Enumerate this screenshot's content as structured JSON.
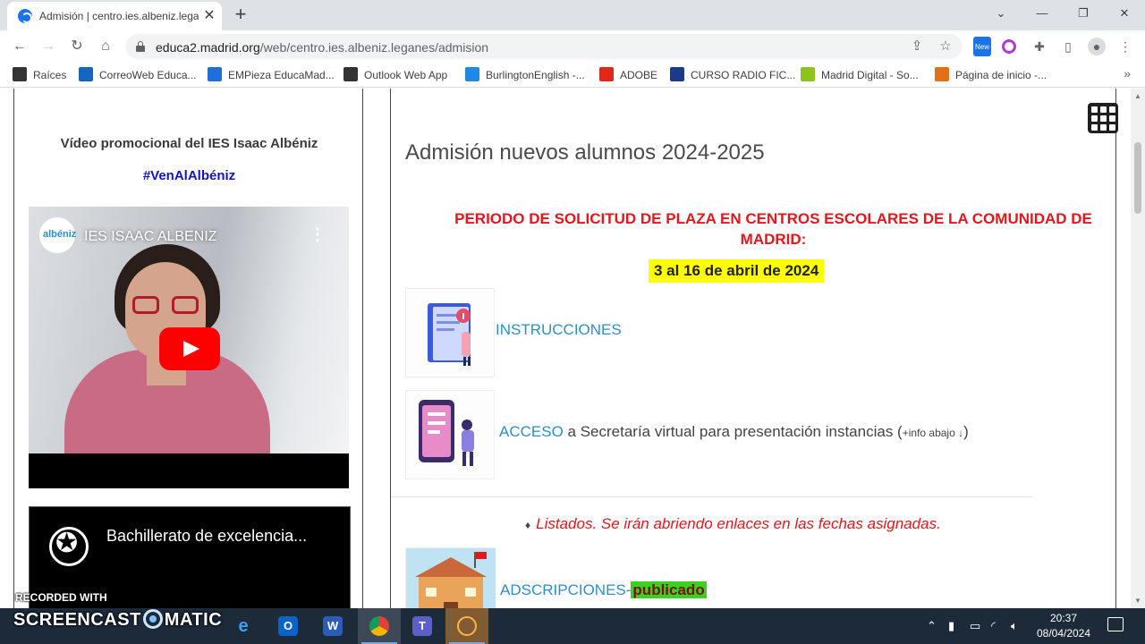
{
  "browser": {
    "tab_title": "Admisión | centro.ies.albeniz.lega",
    "url_domain": "educa2.madrid.org",
    "url_path": "/web/centro.ies.albeniz.leganes/admision",
    "ext_new_badge": "New",
    "bookmarks": [
      {
        "label": "Raíces",
        "color": "#333333"
      },
      {
        "label": "CorreoWeb Educa...",
        "color": "#1565c0"
      },
      {
        "label": "EMPieza EducaMad...",
        "color": "#1e6fd9"
      },
      {
        "label": "Outlook Web App",
        "color": "#333333"
      },
      {
        "label": "BurlingtonEnglish -...",
        "color": "#1e88e5"
      },
      {
        "label": "ADOBE",
        "color": "#e0291a"
      },
      {
        "label": "CURSO RADIO FIC...",
        "color": "#1a3a8c"
      },
      {
        "label": "Madrid Digital - So...",
        "color": "#8dc21f"
      },
      {
        "label": "Página de inicio -...",
        "color": "#e0711a"
      }
    ]
  },
  "left_panel": {
    "promo_title": "Vídeo promocional del IES Isaac Albéniz",
    "hashtag": "#VenAlAlbéniz",
    "video1": {
      "title": "IES ISAAC ALBENIZ",
      "logo_text": "albéniz",
      "menu": "⋮"
    },
    "video2": {
      "title": "Bachillerato de excelencia..."
    }
  },
  "main": {
    "title": "Admisión nuevos alumnos 2024-2025",
    "period_heading": "PERIODO DE SOLICITUD DE PLAZA EN CENTROS ESCOLARES DE LA COMUNIDAD DE MADRID:",
    "period_dates": "3 al 16 de abril de 2024",
    "instructions_link": "INSTRUCCIONES",
    "access_link": "ACCESO",
    "access_text": " a Secretaría virtual para presentación instancias (",
    "access_note": "+info abajo ↓",
    "access_close": ")",
    "listados_text": "Listados. Se irán abriendo enlaces en las fechas asignadas.",
    "adscripciones_link": "ADSCRIPCIONES-",
    "adscripciones_status": "publicado"
  },
  "watermark": {
    "recorded_with": "RECORDED WITH",
    "brand_left": "SCREENCAST",
    "brand_right": "MATIC"
  },
  "taskbar": {
    "time": "20:37",
    "date": "08/04/2024"
  },
  "colors": {
    "heading_red": "#e3171c",
    "link_blue": "#2d8fc7",
    "highlight_yellow": "#ffff00",
    "highlight_green": "#3bd11e",
    "hashtag_blue": "#1313c8"
  }
}
